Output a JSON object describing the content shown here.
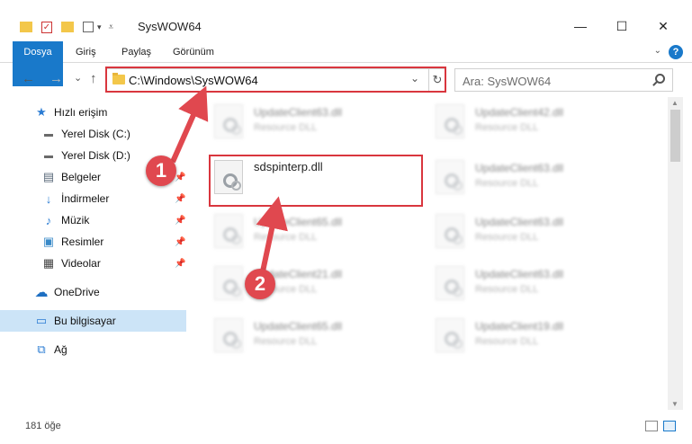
{
  "window": {
    "title": "SysWOW64",
    "minimize": "—",
    "maximize": "☐",
    "close": "✕"
  },
  "ribbon": {
    "tabs": [
      "Dosya",
      "Giriş",
      "Paylaş",
      "Görünüm"
    ],
    "help": "?"
  },
  "nav": {
    "back": "←",
    "forward": "→",
    "recent": "⌄",
    "up": "↑",
    "address": "C:\\Windows\\SysWOW64",
    "search_placeholder": "Ara: SysWOW64"
  },
  "sidebar": {
    "items": [
      {
        "label": "Hızlı erişim",
        "icon": "star-icon",
        "glyph": "★",
        "color": "#2b7cd3",
        "pinned": false
      },
      {
        "label": "Yerel Disk (C:)",
        "icon": "drive-icon",
        "glyph": "▬",
        "color": "#6a6a6a",
        "pinned": true
      },
      {
        "label": "Yerel Disk (D:)",
        "icon": "drive-icon",
        "glyph": "▬",
        "color": "#6a6a6a",
        "pinned": true
      },
      {
        "label": "Belgeler",
        "icon": "documents-icon",
        "glyph": "▤",
        "color": "#5a6a7a",
        "pinned": true
      },
      {
        "label": "İndirmeler",
        "icon": "download-icon",
        "glyph": "↓",
        "color": "#2b7cd3",
        "pinned": true
      },
      {
        "label": "Müzik",
        "icon": "music-icon",
        "glyph": "♪",
        "color": "#2b7cd3",
        "pinned": true
      },
      {
        "label": "Resimler",
        "icon": "pictures-icon",
        "glyph": "▣",
        "color": "#3a8ac8",
        "pinned": true
      },
      {
        "label": "Videolar",
        "icon": "video-icon",
        "glyph": "▦",
        "color": "#444",
        "pinned": true
      },
      {
        "label": "OneDrive",
        "icon": "cloud-icon",
        "glyph": "☁",
        "color": "#1e6fc2",
        "pinned": false
      },
      {
        "label": "Bu bilgisayar",
        "icon": "computer-icon",
        "glyph": "▭",
        "color": "#2b7cd3",
        "pinned": false
      },
      {
        "label": "Ağ",
        "icon": "network-icon",
        "glyph": "⧉",
        "color": "#2b7cd3",
        "pinned": false
      }
    ]
  },
  "files": {
    "left": [
      {
        "name": "UpdateClient63.dll",
        "desc": "Resource DLL",
        "blurred": true
      },
      {
        "name": "sdspinterp.dll",
        "desc": "",
        "blurred": false
      },
      {
        "name": "UpdateClient65.dll",
        "desc": "Resource DLL",
        "blurred": true
      },
      {
        "name": "UpdateClient21.dll",
        "desc": "Resource DLL",
        "blurred": true
      },
      {
        "name": "UpdateClient65.dll",
        "desc": "Resource DLL",
        "blurred": true
      }
    ],
    "right": [
      {
        "name": "UpdateClient42.dll",
        "desc": "Resource DLL",
        "blurred": true
      },
      {
        "name": "UpdateClient63.dll",
        "desc": "Resource DLL",
        "blurred": true
      },
      {
        "name": "UpdateClient63.dll",
        "desc": "Resource DLL",
        "blurred": true
      },
      {
        "name": "UpdateClient63.dll",
        "desc": "Resource DLL",
        "blurred": true
      },
      {
        "name": "UpdateClient19.dll",
        "desc": "Resource DLL",
        "blurred": true
      }
    ]
  },
  "status": {
    "count": "181 öğe"
  },
  "callouts": [
    "1",
    "2"
  ],
  "colors": {
    "accent": "#1979ca",
    "highlight": "#d9363e",
    "callout": "#e0484f",
    "selected": "#cce4f7"
  }
}
